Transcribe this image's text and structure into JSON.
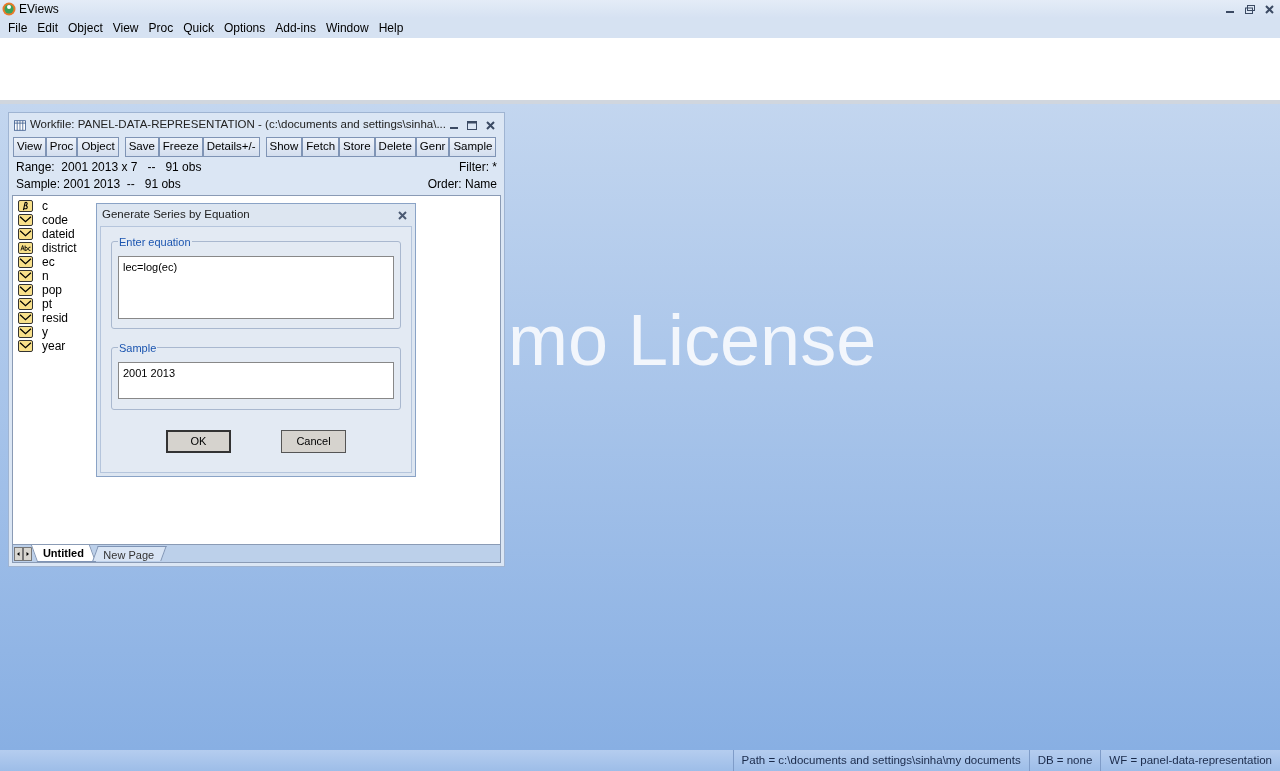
{
  "app": {
    "title": "EViews"
  },
  "menu": [
    "File",
    "Edit",
    "Object",
    "View",
    "Proc",
    "Quick",
    "Options",
    "Add-ins",
    "Window",
    "Help"
  ],
  "watermark": "mo License",
  "workfile": {
    "title": "Workfile: PANEL-DATA-REPRESENTATION - (c:\\documents and settings\\sinha\\...",
    "toolbar": [
      [
        "View",
        "Proc",
        "Object"
      ],
      [
        "Save",
        "Freeze",
        "Details+/-"
      ],
      [
        "Show",
        "Fetch",
        "Store",
        "Delete",
        "Genr",
        "Sample"
      ]
    ],
    "range": "Range:  2001 2013 x 7   --   91 obs",
    "filter": "Filter: *",
    "sample": "Sample: 2001 2013  --   91 obs",
    "order": "Order: Name",
    "objects": [
      {
        "kind": "coef",
        "name": "c"
      },
      {
        "kind": "series",
        "name": "code"
      },
      {
        "kind": "series",
        "name": "dateid"
      },
      {
        "kind": "alpha",
        "name": "district"
      },
      {
        "kind": "series",
        "name": "ec"
      },
      {
        "kind": "series",
        "name": "n"
      },
      {
        "kind": "series",
        "name": "pop"
      },
      {
        "kind": "series",
        "name": "pt"
      },
      {
        "kind": "series",
        "name": "resid"
      },
      {
        "kind": "series",
        "name": "y"
      },
      {
        "kind": "series",
        "name": "year"
      }
    ],
    "tabs": [
      {
        "label": "Untitled",
        "selected": true
      },
      {
        "label": "New Page",
        "selected": false
      }
    ]
  },
  "dialog": {
    "title": "Generate Series by Equation",
    "equation_label": "Enter equation",
    "equation": "lec=log(ec)",
    "sample_label": "Sample",
    "sample": "2001 2013",
    "buttons": [
      "OK",
      "Cancel"
    ]
  },
  "status_bar": [
    "Path = c:\\documents and settings\\sinha\\my documents",
    "DB = none",
    "WF = panel-data-representation"
  ]
}
